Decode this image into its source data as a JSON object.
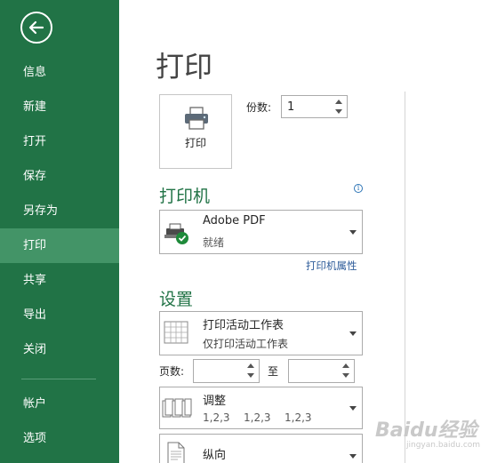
{
  "sidebar": {
    "items": [
      {
        "label": "信息"
      },
      {
        "label": "新建"
      },
      {
        "label": "打开"
      },
      {
        "label": "保存"
      },
      {
        "label": "另存为"
      },
      {
        "label": "打印"
      },
      {
        "label": "共享"
      },
      {
        "label": "导出"
      },
      {
        "label": "关闭"
      },
      {
        "label": "帐户"
      },
      {
        "label": "选项"
      }
    ],
    "active": "打印"
  },
  "main": {
    "title": "打印",
    "print_button_label": "打印",
    "copies_label": "份数:",
    "copies_value": "1",
    "printer_heading": "打印机",
    "printer_name": "Adobe PDF",
    "printer_status": "就绪",
    "printer_properties_link": "打印机属性",
    "settings_heading": "设置",
    "print_what": "打印活动工作表",
    "print_what_desc": "仅打印活动工作表",
    "pages_label": "页数:",
    "to_label": "至",
    "collate": "调整",
    "collate_seq": [
      "1,2,3",
      "1,2,3",
      "1,2,3"
    ],
    "orientation": "纵向"
  },
  "watermark": {
    "text": "Baidu经验",
    "sub": "jingyan.baidu.com"
  },
  "colors": {
    "sidebar": "#217346",
    "sidebar_active": "#439467",
    "heading": "#217346"
  }
}
